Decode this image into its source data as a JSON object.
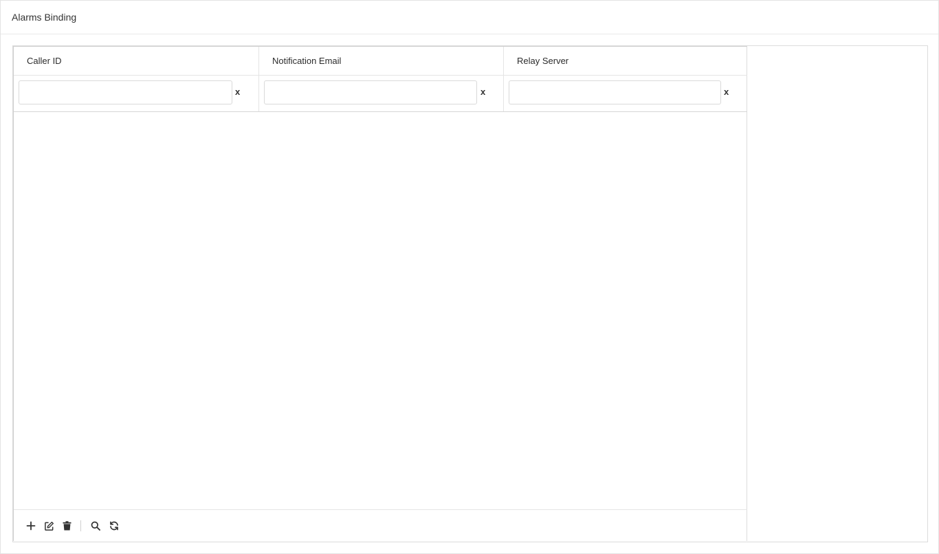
{
  "page": {
    "title": "Alarms Binding"
  },
  "grid": {
    "columns": [
      {
        "label": "Caller ID",
        "filter_value": "",
        "filter_placeholder": "",
        "clear_label": "x"
      },
      {
        "label": "Notification Email",
        "filter_value": "",
        "filter_placeholder": "",
        "clear_label": "x"
      },
      {
        "label": "Relay Server",
        "filter_value": "",
        "filter_placeholder": "",
        "clear_label": "x"
      }
    ],
    "rows": []
  },
  "toolbar": {
    "icons": [
      "plus-icon",
      "edit-icon",
      "trash-icon",
      "search-icon",
      "refresh-icon"
    ]
  },
  "colors": {
    "border": "#dcdcdc",
    "text": "#333333",
    "icon": "#333333"
  }
}
